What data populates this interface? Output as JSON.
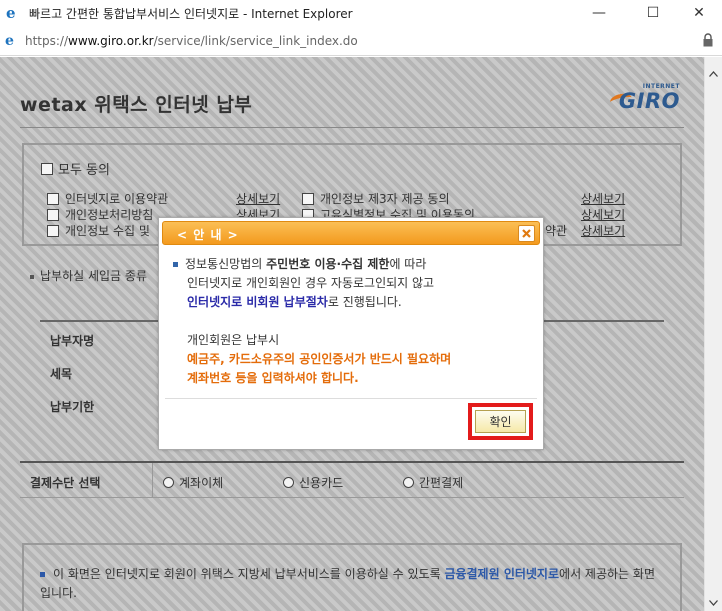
{
  "window": {
    "title": "빠르고 간편한 통합납부서비스 인터넷지로 - Internet Explorer",
    "minimize": "—",
    "maximize": "☐",
    "close": "✕"
  },
  "address": {
    "scheme": "https://",
    "host": "www.giro.or.kr",
    "path": "/service/link/service_link_index.do"
  },
  "page": {
    "title": "wetax 위택스 인터넷 납부",
    "logo_small": "INTERNET",
    "logo_big": "GIRO"
  },
  "agreement": {
    "all_label": "모두 동의",
    "terms": [
      {
        "label": "인터넷지로 이용약관",
        "detail": "상세보기"
      },
      {
        "label": "개인정보처리방침",
        "detail": "상세보기"
      },
      {
        "label": "개인정보 수집 및",
        "detail": "상세보기"
      },
      {
        "label": "개인정보 제3자 제공 동의",
        "detail": "상세보기"
      },
      {
        "label": "고유식별정보 수집 및 이용동의",
        "detail": "상세보기"
      },
      {
        "label": "약관",
        "detail": "상세보기"
      }
    ]
  },
  "tax_section": {
    "label": "납부하실 세입금 종류",
    "rows": [
      "납부자명",
      "세목",
      "납부기한"
    ]
  },
  "payment": {
    "label": "결제수단 선택",
    "options": [
      "계좌이체",
      "신용카드",
      "간편결제"
    ]
  },
  "notice": {
    "text_prefix": "이 화면은 인터넷지로 회원이 위택스 지방세 납부서비스를 이용하실 수 있도록 ",
    "highlight": "금융결제원 인터넷지로",
    "text_suffix": "에서 제공하는 화면입니다."
  },
  "modal": {
    "title": "< 안 내 >",
    "line1_pre": "정보통신망법의 ",
    "line1_bold": "주민번호 이용·수집 제한",
    "line1_post": "에 따라",
    "line2": "인터넷지로 개인회원인 경우 자동로그인되지 않고",
    "line3_blue": "인터넷지로 비회원 납부절차",
    "line3_post": "로 진행됩니다.",
    "line4": "개인회원은 납부시",
    "line5_orange": "예금주, 카드소유주의 공인인증서가 반드시 필요하며",
    "line6_orange": "계좌번호 등을 입력하셔야 합니다.",
    "confirm": "확인"
  }
}
